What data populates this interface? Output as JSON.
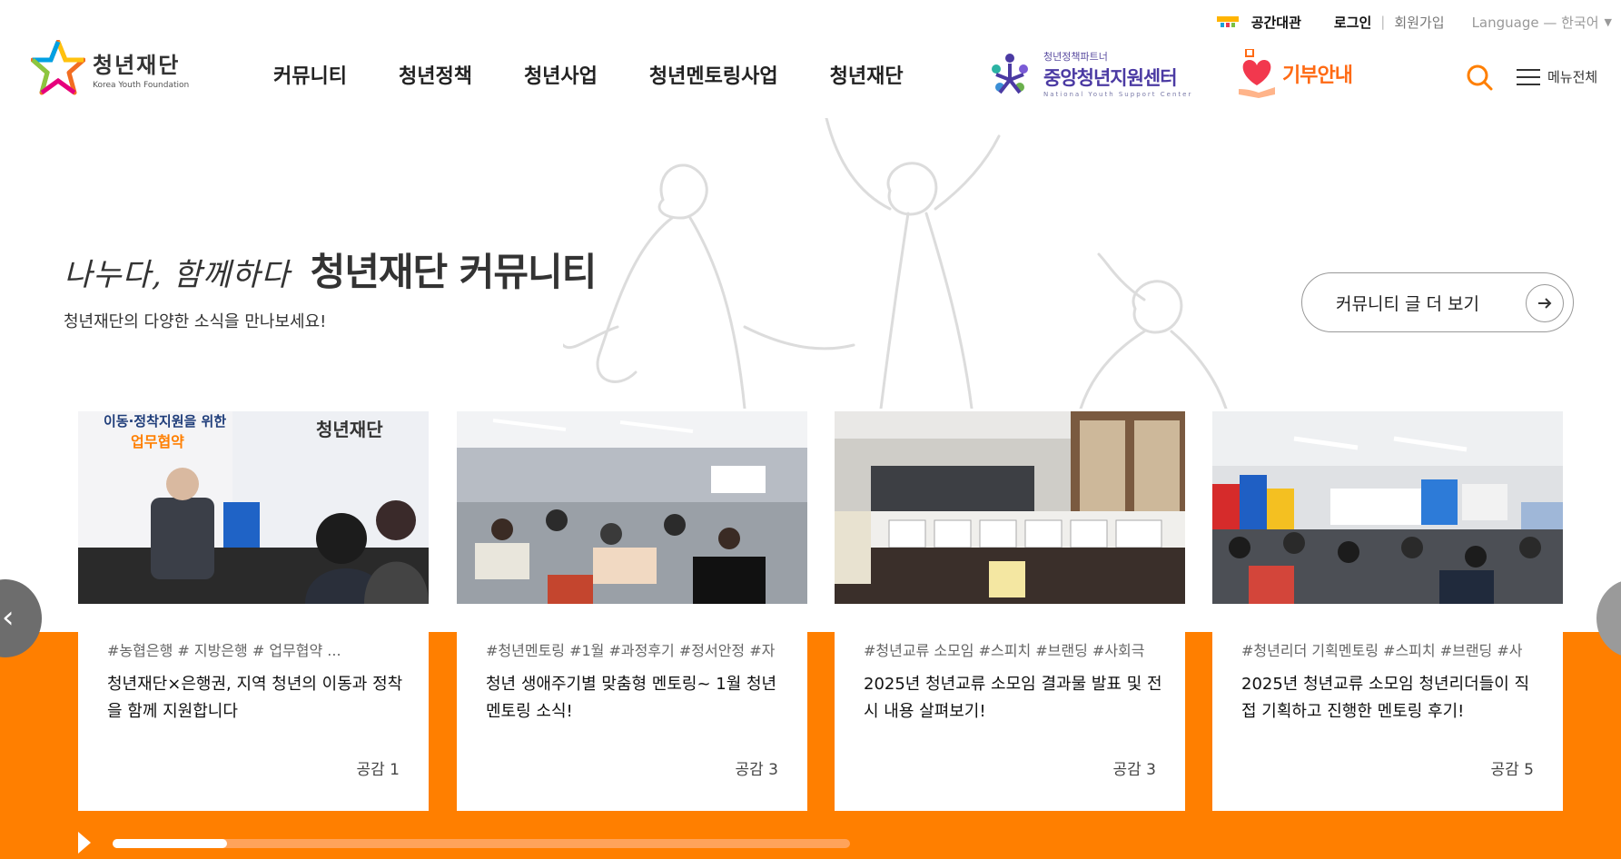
{
  "utility": {
    "space_rental": "공간대관",
    "login": "로그인",
    "separator": "|",
    "signup": "회원가입",
    "language_label": "Language — 한국어"
  },
  "logo": {
    "name_ko": "청년재단",
    "name_en": "Korea Youth Foundation"
  },
  "gnb": [
    "커뮤니티",
    "청년정책",
    "청년사업",
    "청년멘토링사업",
    "청년재단"
  ],
  "partner": {
    "small": "청년정책파트너",
    "big": "중앙청년지원센터",
    "tiny": "National Youth Support Center"
  },
  "donate": {
    "label": "기부안내"
  },
  "menu_all": "메뉴전체",
  "hero": {
    "script": "나누다, 함께하다",
    "title": "청년재단 커뮤니티",
    "subtitle": "청년재단의 다양한 소식을 만나보세요!",
    "more_button": "커뮤니티 글 더 보기"
  },
  "cards": [
    {
      "tags": "#농협은행  # 지방은행  # 업무협약  ...",
      "title": "청년재단×은행권, 지역 청년의 이동과 정착을 함께 지원합니다",
      "likes": "공감 1",
      "banner_text": "이동·정착지원을 위한",
      "banner_sub": "업무협약"
    },
    {
      "tags": "#청년멘토링 #1월 #과정후기 #정서안정 #자",
      "title": "청년 생애주기별 맞춤형 멘토링~ 1월 청년멘토링 소식!",
      "likes": "공감 3"
    },
    {
      "tags": "#청년교류 소모임 #스피치 #브랜딩 #사회극",
      "title": "2025년 청년교류 소모임 결과물 발표 및 전시 내용 살펴보기!",
      "likes": "공감 3"
    },
    {
      "tags": "#청년리더 기획멘토링 #스피치 #브랜딩 #사",
      "title": "2025년 청년교류 소모임 청년리더들이 직접 기획하고 진행한 멘토링 후기!",
      "likes": "공감 5"
    }
  ],
  "slider": {
    "progress": 0.155
  },
  "colors": {
    "accent": "#ff7f00",
    "donate": "#ff6a13",
    "partner": "#4b3aa3"
  },
  "icons": [
    "search-icon",
    "menu-icon",
    "arrow-right-icon",
    "chevron-left-icon",
    "play-icon"
  ]
}
